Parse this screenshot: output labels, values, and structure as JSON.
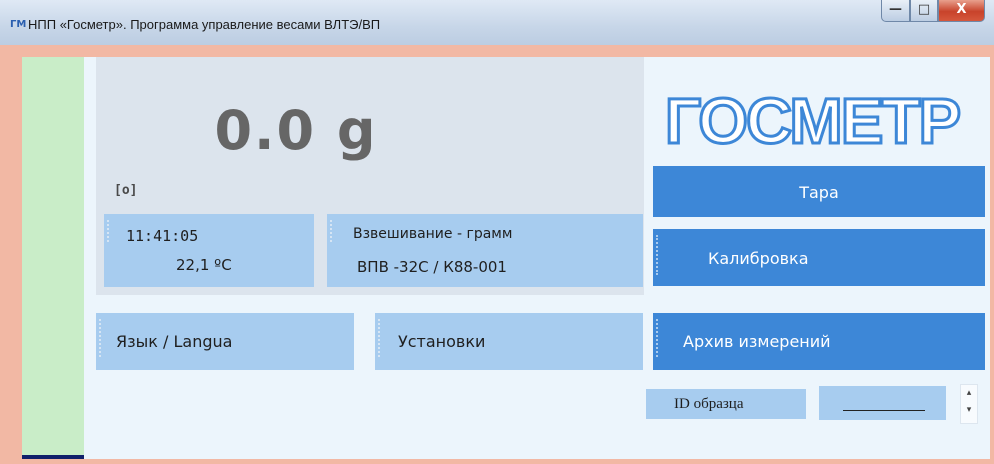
{
  "window": {
    "icon_text": "ГМ",
    "title": "НПП «Госметр». Программа управление весами ВЛТЭ/ВП",
    "minimize": "—",
    "maximize": "□",
    "close": "X"
  },
  "display": {
    "weight": "0.0 g",
    "zero_indicator": "[o]",
    "time": "11:41:05",
    "temperature": "22,1 ºC",
    "mode": "Взвешивание - грамм",
    "device": "ВПВ -32С / К88-001"
  },
  "logo": {
    "text": "ГОСМЕТР",
    "color": "#3d87d7"
  },
  "buttons": {
    "tare": "Тара",
    "calibration": "Калибровка",
    "language": "Язык / Langua",
    "settings": "Установки",
    "archive": "Архив измерений"
  },
  "sample_id": {
    "label": "ID образца",
    "value": "",
    "spin_up": "▴",
    "spin_down": "▾"
  },
  "colors": {
    "accent": "#3d87d7",
    "panel": "#a7ccef",
    "green_strip": "#c9edc8"
  }
}
